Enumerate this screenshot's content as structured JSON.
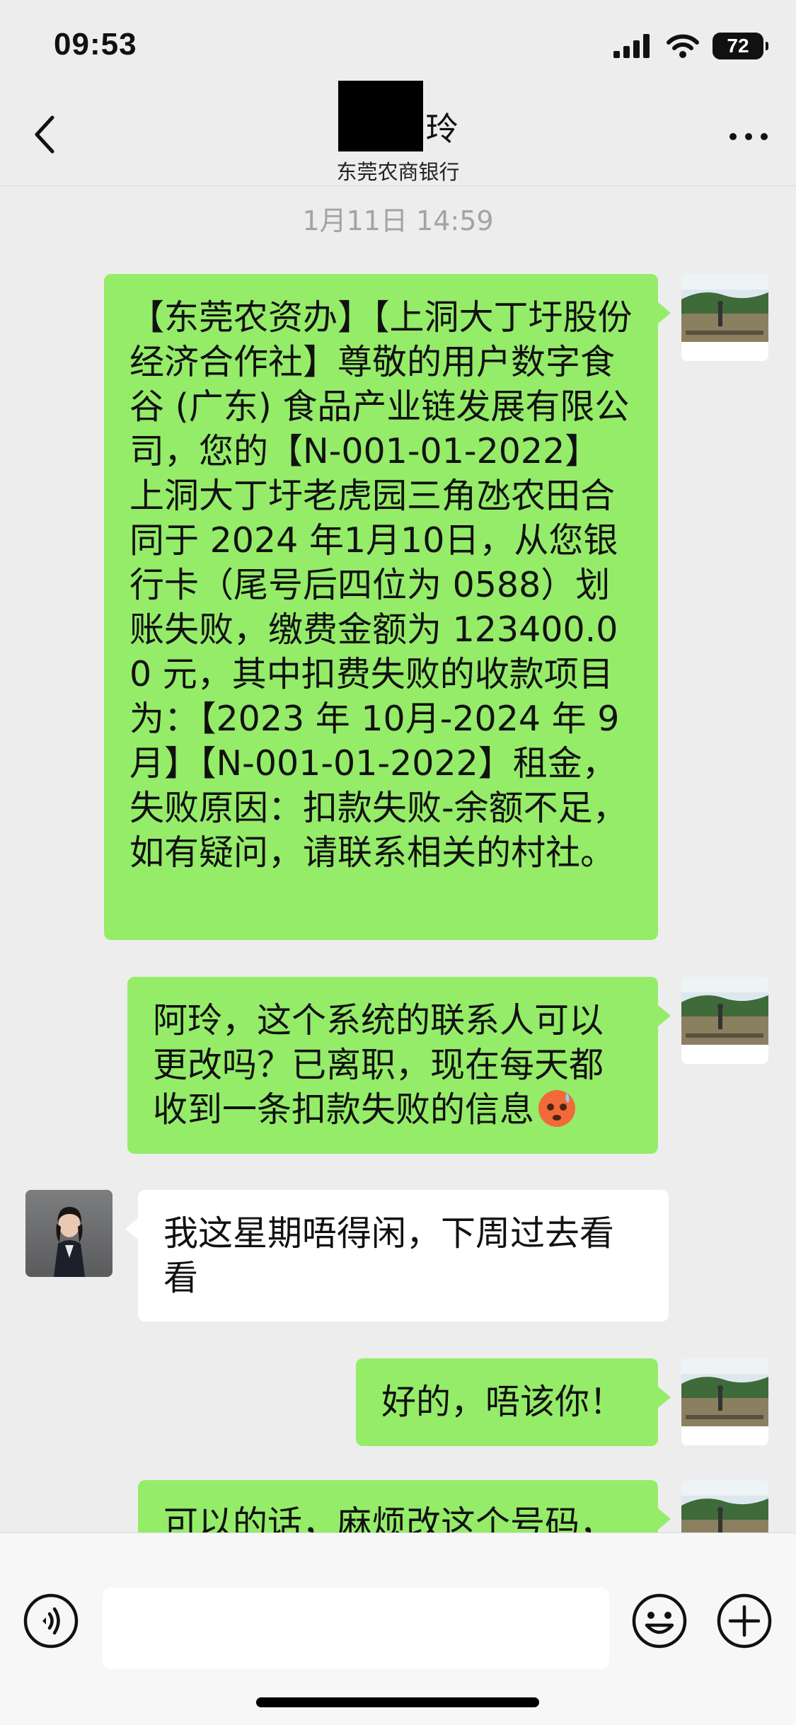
{
  "status_bar": {
    "time": "09:53",
    "battery": "72"
  },
  "header": {
    "title_suffix": "玲",
    "subtitle": "东莞农商银行"
  },
  "chat": {
    "timestamp": "1月11日 14:59",
    "messages": [
      {
        "side": "out",
        "text": "【东莞农资办】【上洞大丁圩股份经济合作社】尊敬的用户数字食谷 (广东) 食品产业链发展有限公司，您的【N-001-01-2022】上洞大丁圩老虎园三角氹农田合同于 2024 年1月10日，从您银行卡（尾号后四位为 0588）划账失败，缴费金额为 123400.00 元，其中扣费失败的收款项目为：【2023 年 10月-2024 年 9月】【N-001-01-2022】租金，失败原因：扣款失败-余额不足，如有疑问，请联系相关的村社。"
      },
      {
        "side": "out",
        "text": "阿玲，这个系统的联系人可以更改吗？已离职，现在每天都收到一条扣款失败的信息",
        "emoji": "anxious-face-emoji"
      },
      {
        "side": "in",
        "text": "我这星期唔得闲，下周过去看看"
      },
      {
        "side": "out",
        "text": "好的，唔该你！"
      },
      {
        "side": "out",
        "text": "可以的话，麻烦改这个号码，"
      }
    ]
  },
  "input": {
    "placeholder": "",
    "value": ""
  },
  "colors": {
    "background": "#ededed",
    "outgoing_bubble": "#95ec69",
    "incoming_bubble": "#ffffff",
    "timestamp_text": "#a3a3a3"
  },
  "icons": {
    "back": "chevron-left-icon",
    "more": "more-horizontal-icon",
    "voice": "voice-input-icon",
    "emoji": "emoji-smile-icon",
    "plus": "plus-circle-icon"
  }
}
